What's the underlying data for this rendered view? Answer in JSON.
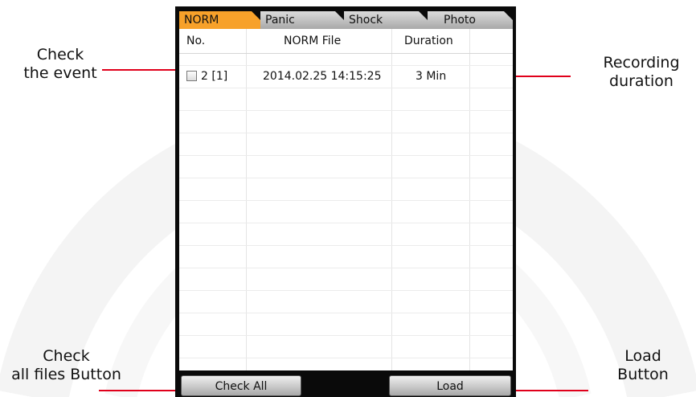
{
  "tabs": [
    "NORM",
    "Panic",
    "Shock",
    "Photo"
  ],
  "active_tab": "NORM",
  "table": {
    "headers": {
      "no": "No.",
      "file": "NORM File",
      "duration": "Duration"
    },
    "rows": [
      {
        "no": "2 [1]",
        "file": "2014.02.25 14:15:25",
        "duration": "3 Min",
        "checked": false
      }
    ]
  },
  "buttons": {
    "check_all": "Check All",
    "load": "Load"
  },
  "annotations": {
    "check_event": [
      "Check",
      "the event"
    ],
    "recording_duration": [
      "Recording",
      "duration"
    ],
    "check_all": [
      "Check",
      "all files Button"
    ],
    "load": [
      "Load",
      "Button"
    ]
  },
  "colors": {
    "active_tab": "#f7a12a",
    "leader": "#e0001b",
    "frame": "#0a0a0a"
  }
}
